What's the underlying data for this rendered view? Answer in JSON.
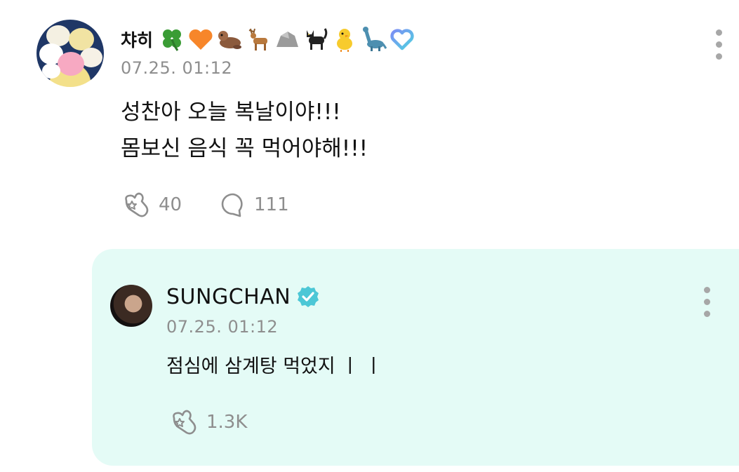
{
  "fan_post": {
    "author": "챠히",
    "name_emojis": [
      "four-leaf-clover",
      "orange-heart",
      "otter",
      "deer",
      "rock",
      "black-cat",
      "chick",
      "sauropod",
      "weverse-heart"
    ],
    "timestamp": "07.25. 01:12",
    "body_lines": [
      "성찬아 오늘 복날이야!!!",
      "몸보신 음식 꼭 먹어야해!!!"
    ],
    "likes": "40",
    "comments": "111"
  },
  "artist_reply": {
    "author": "SUNGCHAN",
    "verified": true,
    "timestamp": "07.25. 01:12",
    "body": "점심에 삼계탕 먹었지 ㅣ ㅣ",
    "likes": "1.3K"
  },
  "colors": {
    "reply_background": "#e4fbf6",
    "verified_badge": "#4cc7d6",
    "muted_text": "#8e8e8e"
  }
}
